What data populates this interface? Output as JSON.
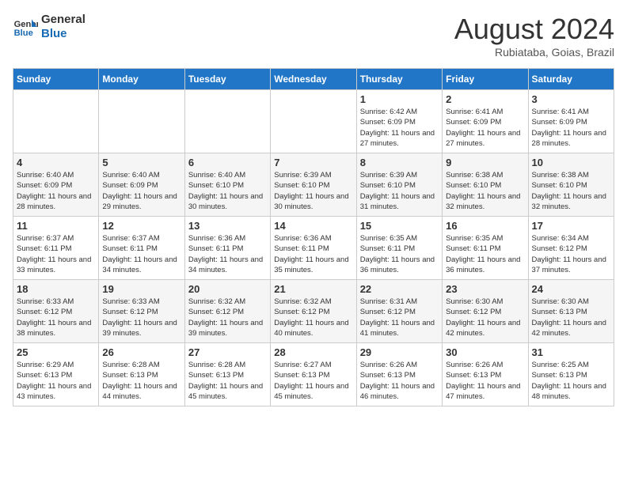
{
  "header": {
    "logo_line1": "General",
    "logo_line2": "Blue",
    "month_title": "August 2024",
    "subtitle": "Rubiataba, Goias, Brazil"
  },
  "days_of_week": [
    "Sunday",
    "Monday",
    "Tuesday",
    "Wednesday",
    "Thursday",
    "Friday",
    "Saturday"
  ],
  "weeks": [
    [
      {
        "day": "",
        "info": ""
      },
      {
        "day": "",
        "info": ""
      },
      {
        "day": "",
        "info": ""
      },
      {
        "day": "",
        "info": ""
      },
      {
        "day": "1",
        "info": "Sunrise: 6:42 AM\nSunset: 6:09 PM\nDaylight: 11 hours and 27 minutes."
      },
      {
        "day": "2",
        "info": "Sunrise: 6:41 AM\nSunset: 6:09 PM\nDaylight: 11 hours and 27 minutes."
      },
      {
        "day": "3",
        "info": "Sunrise: 6:41 AM\nSunset: 6:09 PM\nDaylight: 11 hours and 28 minutes."
      }
    ],
    [
      {
        "day": "4",
        "info": "Sunrise: 6:40 AM\nSunset: 6:09 PM\nDaylight: 11 hours and 28 minutes."
      },
      {
        "day": "5",
        "info": "Sunrise: 6:40 AM\nSunset: 6:09 PM\nDaylight: 11 hours and 29 minutes."
      },
      {
        "day": "6",
        "info": "Sunrise: 6:40 AM\nSunset: 6:10 PM\nDaylight: 11 hours and 30 minutes."
      },
      {
        "day": "7",
        "info": "Sunrise: 6:39 AM\nSunset: 6:10 PM\nDaylight: 11 hours and 30 minutes."
      },
      {
        "day": "8",
        "info": "Sunrise: 6:39 AM\nSunset: 6:10 PM\nDaylight: 11 hours and 31 minutes."
      },
      {
        "day": "9",
        "info": "Sunrise: 6:38 AM\nSunset: 6:10 PM\nDaylight: 11 hours and 32 minutes."
      },
      {
        "day": "10",
        "info": "Sunrise: 6:38 AM\nSunset: 6:10 PM\nDaylight: 11 hours and 32 minutes."
      }
    ],
    [
      {
        "day": "11",
        "info": "Sunrise: 6:37 AM\nSunset: 6:11 PM\nDaylight: 11 hours and 33 minutes."
      },
      {
        "day": "12",
        "info": "Sunrise: 6:37 AM\nSunset: 6:11 PM\nDaylight: 11 hours and 34 minutes."
      },
      {
        "day": "13",
        "info": "Sunrise: 6:36 AM\nSunset: 6:11 PM\nDaylight: 11 hours and 34 minutes."
      },
      {
        "day": "14",
        "info": "Sunrise: 6:36 AM\nSunset: 6:11 PM\nDaylight: 11 hours and 35 minutes."
      },
      {
        "day": "15",
        "info": "Sunrise: 6:35 AM\nSunset: 6:11 PM\nDaylight: 11 hours and 36 minutes."
      },
      {
        "day": "16",
        "info": "Sunrise: 6:35 AM\nSunset: 6:11 PM\nDaylight: 11 hours and 36 minutes."
      },
      {
        "day": "17",
        "info": "Sunrise: 6:34 AM\nSunset: 6:12 PM\nDaylight: 11 hours and 37 minutes."
      }
    ],
    [
      {
        "day": "18",
        "info": "Sunrise: 6:33 AM\nSunset: 6:12 PM\nDaylight: 11 hours and 38 minutes."
      },
      {
        "day": "19",
        "info": "Sunrise: 6:33 AM\nSunset: 6:12 PM\nDaylight: 11 hours and 39 minutes."
      },
      {
        "day": "20",
        "info": "Sunrise: 6:32 AM\nSunset: 6:12 PM\nDaylight: 11 hours and 39 minutes."
      },
      {
        "day": "21",
        "info": "Sunrise: 6:32 AM\nSunset: 6:12 PM\nDaylight: 11 hours and 40 minutes."
      },
      {
        "day": "22",
        "info": "Sunrise: 6:31 AM\nSunset: 6:12 PM\nDaylight: 11 hours and 41 minutes."
      },
      {
        "day": "23",
        "info": "Sunrise: 6:30 AM\nSunset: 6:12 PM\nDaylight: 11 hours and 42 minutes."
      },
      {
        "day": "24",
        "info": "Sunrise: 6:30 AM\nSunset: 6:13 PM\nDaylight: 11 hours and 42 minutes."
      }
    ],
    [
      {
        "day": "25",
        "info": "Sunrise: 6:29 AM\nSunset: 6:13 PM\nDaylight: 11 hours and 43 minutes."
      },
      {
        "day": "26",
        "info": "Sunrise: 6:28 AM\nSunset: 6:13 PM\nDaylight: 11 hours and 44 minutes."
      },
      {
        "day": "27",
        "info": "Sunrise: 6:28 AM\nSunset: 6:13 PM\nDaylight: 11 hours and 45 minutes."
      },
      {
        "day": "28",
        "info": "Sunrise: 6:27 AM\nSunset: 6:13 PM\nDaylight: 11 hours and 45 minutes."
      },
      {
        "day": "29",
        "info": "Sunrise: 6:26 AM\nSunset: 6:13 PM\nDaylight: 11 hours and 46 minutes."
      },
      {
        "day": "30",
        "info": "Sunrise: 6:26 AM\nSunset: 6:13 PM\nDaylight: 11 hours and 47 minutes."
      },
      {
        "day": "31",
        "info": "Sunrise: 6:25 AM\nSunset: 6:13 PM\nDaylight: 11 hours and 48 minutes."
      }
    ]
  ]
}
